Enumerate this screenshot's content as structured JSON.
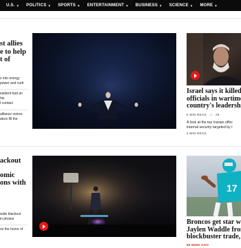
{
  "nav": {
    "items": [
      "U.S.",
      "POLITICS",
      "SPORTS",
      "ENTERTAINMENT",
      "BUSINESS",
      "SCIENCE",
      "MORE"
    ],
    "chevron": "chevron-down-icon"
  },
  "left_story_1": {
    "headline_lines": [
      "st allies",
      "e to help",
      "t of"
    ],
    "blurbs": [
      "s into energy\npower and curb",
      "esident had an\nhis\nt contact",
      "alliance voices\nators fill the"
    ]
  },
  "left_story_2": {
    "headline_lines": [
      "ackout",
      "omic",
      "ons with"
    ],
    "blurbs": [
      "wide blackout\nin photos",
      "ve the honor of"
    ]
  },
  "right_story_1": {
    "headline_lines": [
      "Israel says it killed 2",
      "officials in wartime h",
      "country's leadership"
    ],
    "read_time": "6 MIN READ",
    "comments": "26",
    "comment_icon": "comment-icon",
    "blurb_lines": [
      "A look at the top Iranian offici",
      "internal security targeted by I"
    ],
    "read_time_2": "4 MIN READ"
  },
  "right_story_2": {
    "headline_lines": [
      "Broncos get star wid",
      "Jaylen Waddle from",
      "blockbuster trade, A"
    ],
    "age": "55 MINS AGO"
  },
  "colors": {
    "nav_bg": "#0b0b0b",
    "accent_red": "#e61919",
    "dolphins_aqua": "#0fb2c2"
  }
}
